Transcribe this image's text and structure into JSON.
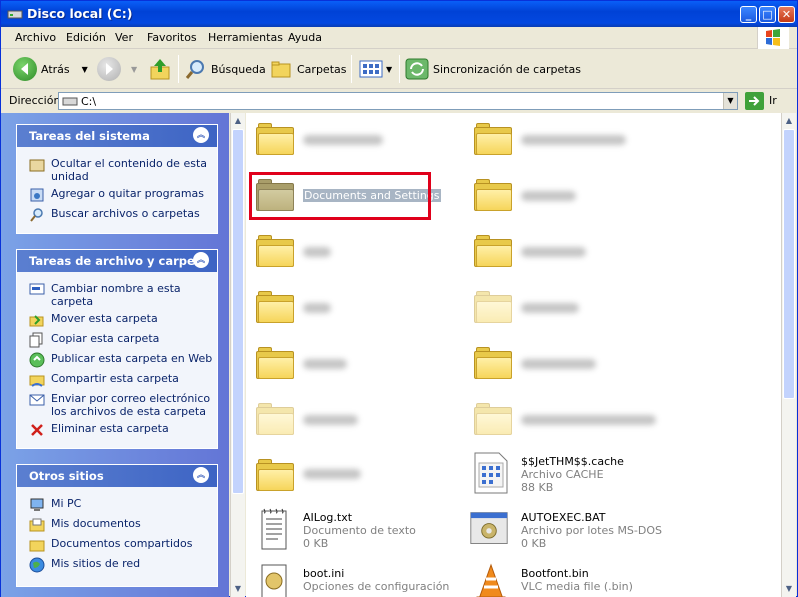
{
  "window": {
    "title": "Disco local (C:)"
  },
  "menu": [
    "Archivo",
    "Edición",
    "Ver",
    "Favoritos",
    "Herramientas",
    "Ayuda"
  ],
  "toolbar": {
    "back": "Atrás",
    "search": "Búsqueda",
    "folders": "Carpetas",
    "sync": "Sincronización de carpetas"
  },
  "address": {
    "label": "Dirección",
    "value": "C:\\",
    "go": "Ir"
  },
  "panels": {
    "system": {
      "title": "Tareas del sistema",
      "items": [
        "Ocultar el contenido de esta unidad",
        "Agregar o quitar programas",
        "Buscar archivos o carpetas"
      ]
    },
    "filetasks": {
      "title": "Tareas de archivo y carpeta",
      "items": [
        "Cambiar nombre a esta carpeta",
        "Mover esta carpeta",
        "Copiar esta carpeta",
        "Publicar esta carpeta en Web",
        "Compartir esta carpeta",
        "Enviar por correo electrónico los archivos de esta carpeta",
        "Eliminar esta carpeta"
      ]
    },
    "places": {
      "title": "Otros sitios",
      "items": [
        "Mi PC",
        "Mis documentos",
        "Documentos compartidos",
        "Mis sitios de red"
      ]
    }
  },
  "files": {
    "docs_settings": "Documents and Settings",
    "jet": {
      "name": "$$JetTHM$$.cache",
      "type": "Archivo CACHE",
      "size": "88 KB"
    },
    "ailog": {
      "name": "AILog.txt",
      "type": "Documento de texto",
      "size": "0 KB"
    },
    "autoexec": {
      "name": "AUTOEXEC.BAT",
      "type": "Archivo por lotes MS-DOS",
      "size": "0 KB"
    },
    "bootini": {
      "name": "boot.ini",
      "type": "Opciones de configuración"
    },
    "bootfont": {
      "name": "Bootfont.bin",
      "type": "VLC media file (.bin)"
    }
  }
}
